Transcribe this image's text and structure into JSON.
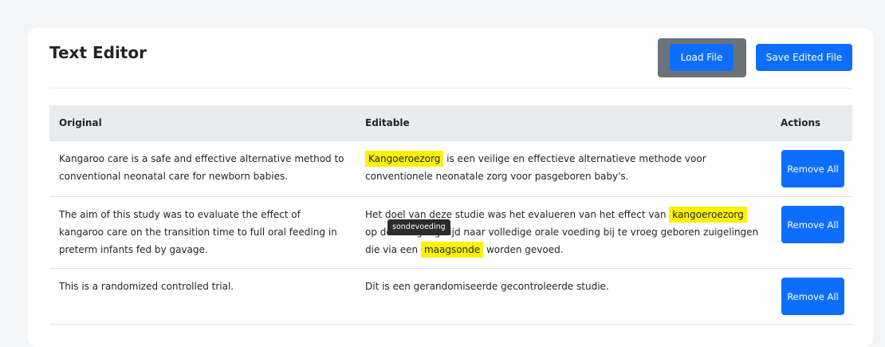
{
  "header": {
    "title": "Text Editor",
    "load_label": "Load File",
    "save_label": "Save Edited File"
  },
  "table": {
    "columns": [
      "Original",
      "Editable",
      "Actions"
    ],
    "remove_label": "Remove All",
    "rows": [
      {
        "original": "Kangaroo care is a safe and effective alternative method to conventional neonatal care for newborn babies.",
        "editable": {
          "hl1": "Kangoeroezorg",
          "t1": " is een veilige en effectieve alternatieve methode voor conventionele neonatale zorg voor pasgeboren baby's."
        }
      },
      {
        "original": "The aim of this study was to evaluate the effect of kangaroo care on the transition time to full oral feeding in preterm infants fed by gavage.",
        "editable": {
          "t1": "Het doel van deze studie was het evalueren van het effect van ",
          "hl1": "kangoeroezorg",
          "t2": " op de overgangstijd naar volledige orale voeding bij te vroeg geboren zuigelingen die via een ",
          "hl2": "maagsonde",
          "t3": " worden gevoed.",
          "tooltip": "sondevoeding"
        }
      },
      {
        "original": "This is a randomized controlled trial.",
        "editable": {
          "t1": "Dit is een gerandomiseerde gecontroleerde studie."
        }
      }
    ]
  },
  "colors": {
    "primary": "#0d6efd",
    "highlight": "#fff200",
    "header_bg": "#e9ecef",
    "tooltip_bg": "#2b2b2b"
  }
}
